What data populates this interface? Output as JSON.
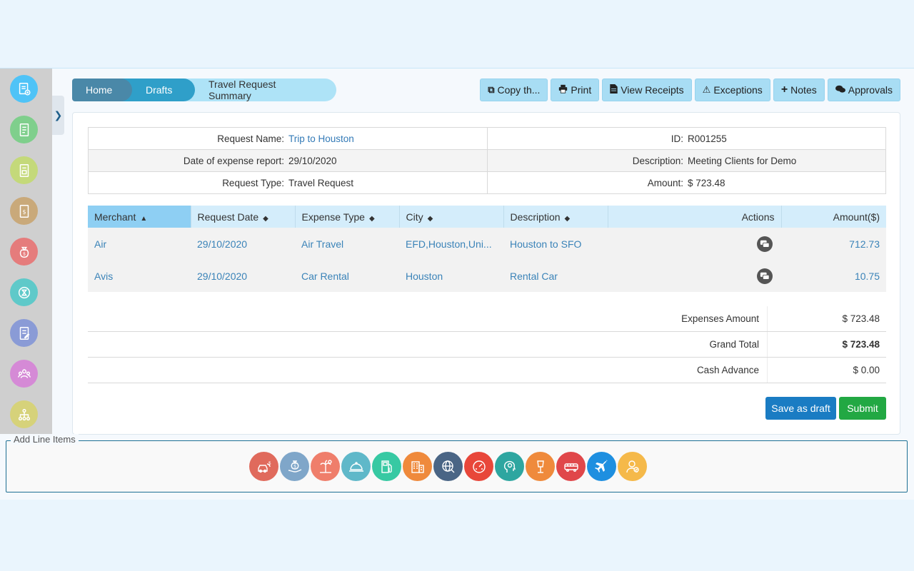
{
  "breadcrumb": {
    "home": "Home",
    "drafts": "Drafts",
    "current": "Travel Request Summary"
  },
  "toolbar": {
    "copy": "Copy th...",
    "print": "Print",
    "view_receipts": "View Receipts",
    "exceptions": "Exceptions",
    "notes": "Notes",
    "approvals": "Approvals"
  },
  "sidebar": {
    "icons": [
      {
        "name": "new-document-icon",
        "color": "#4fc3f7"
      },
      {
        "name": "document-list-icon",
        "color": "#7fcf8c"
      },
      {
        "name": "approved-document-icon",
        "color": "#c4d97a"
      },
      {
        "name": "invoice-icon",
        "color": "#c9a97a"
      },
      {
        "name": "money-bag-icon",
        "color": "#e57c7c"
      },
      {
        "name": "pending-icon",
        "color": "#5fc9c9"
      },
      {
        "name": "report-icon",
        "color": "#8a9bd6"
      },
      {
        "name": "team-icon",
        "color": "#d58ad6"
      },
      {
        "name": "hierarchy-icon",
        "color": "#d6d27a"
      }
    ]
  },
  "info": {
    "request_name_label": "Request Name:",
    "request_name": "Trip to Houston",
    "id_label": "ID:",
    "id": "R001255",
    "date_label": "Date of expense report:",
    "date": "29/10/2020",
    "description_label": "Description:",
    "description": "Meeting Clients for Demo",
    "type_label": "Request Type:",
    "type": "Travel Request",
    "amount_label": "Amount:",
    "amount": "$ 723.48"
  },
  "items": {
    "headers": [
      "Merchant",
      "Request Date",
      "Expense Type",
      "City",
      "Description",
      "Actions",
      "Amount($)"
    ],
    "rows": [
      {
        "merchant": "Air",
        "date": "29/10/2020",
        "type": "Air Travel",
        "city": "EFD,Houston,Uni...",
        "description": "Houston to SFO",
        "amount": "712.73"
      },
      {
        "merchant": "Avis",
        "date": "29/10/2020",
        "type": "Car Rental",
        "city": "Houston",
        "description": "Rental Car",
        "amount": "10.75"
      }
    ]
  },
  "totals": {
    "expenses_label": "Expenses Amount",
    "expenses": "$ 723.48",
    "grand_label": "Grand Total",
    "grand": "$ 723.48",
    "cash_label": "Cash Advance",
    "cash": "$ 0.00"
  },
  "buttons": {
    "save_draft": "Save as draft",
    "submit": "Submit"
  },
  "line_items": {
    "legend": "Add Line Items",
    "icons": [
      {
        "name": "car-expense-icon",
        "color": "#e06a5c"
      },
      {
        "name": "money-hand-icon",
        "color": "#7fa6c9"
      },
      {
        "name": "beach-icon",
        "color": "#ef7e6b"
      },
      {
        "name": "meal-cloche-icon",
        "color": "#5fb8c9"
      },
      {
        "name": "fuel-pump-icon",
        "color": "#37c9a3"
      },
      {
        "name": "hotel-icon",
        "color": "#ef8a3c"
      },
      {
        "name": "globe-icon",
        "color": "#4a6585"
      },
      {
        "name": "speedometer-icon",
        "color": "#e8473a"
      },
      {
        "name": "brain-gear-icon",
        "color": "#2ea6a0"
      },
      {
        "name": "podium-icon",
        "color": "#ef8a3c"
      },
      {
        "name": "bus-icon",
        "color": "#e0474a"
      },
      {
        "name": "airplane-icon",
        "color": "#1e8fe0"
      },
      {
        "name": "support-agent-icon",
        "color": "#f5b94a"
      }
    ]
  }
}
